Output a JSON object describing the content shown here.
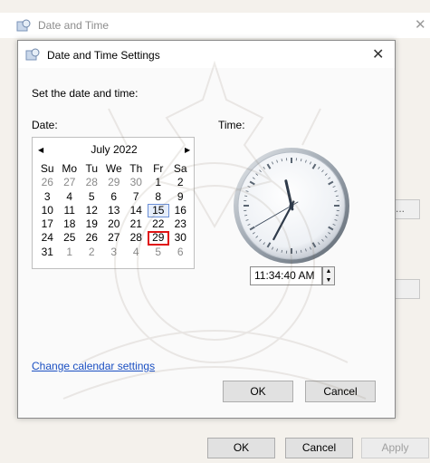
{
  "outer": {
    "title": "Date and Time",
    "close_glyph": "✕",
    "side_button_label": "...",
    "ok_label": "OK",
    "cancel_label": "Cancel",
    "apply_label": "Apply"
  },
  "dialog": {
    "title": "Date and Time Settings",
    "close_glyph": "✕",
    "set_label": "Set the date and time:",
    "date_label": "Date:",
    "time_label": "Time:",
    "link_label": "Change calendar settings",
    "ok_label": "OK",
    "cancel_label": "Cancel"
  },
  "calendar": {
    "month_label": "July 2022",
    "prev_glyph": "◀",
    "next_glyph": "▶",
    "weekdays": [
      "Su",
      "Mo",
      "Tu",
      "We",
      "Th",
      "Fr",
      "Sa"
    ],
    "weeks": [
      [
        {
          "d": "26",
          "o": true
        },
        {
          "d": "27",
          "o": true
        },
        {
          "d": "28",
          "o": true
        },
        {
          "d": "29",
          "o": true
        },
        {
          "d": "30",
          "o": true
        },
        {
          "d": "1"
        },
        {
          "d": "2"
        }
      ],
      [
        {
          "d": "3"
        },
        {
          "d": "4"
        },
        {
          "d": "5"
        },
        {
          "d": "6"
        },
        {
          "d": "7"
        },
        {
          "d": "8"
        },
        {
          "d": "9"
        }
      ],
      [
        {
          "d": "10"
        },
        {
          "d": "11"
        },
        {
          "d": "12"
        },
        {
          "d": "13"
        },
        {
          "d": "14"
        },
        {
          "d": "15",
          "today": true
        },
        {
          "d": "16"
        }
      ],
      [
        {
          "d": "17"
        },
        {
          "d": "18"
        },
        {
          "d": "19"
        },
        {
          "d": "20"
        },
        {
          "d": "21"
        },
        {
          "d": "22"
        },
        {
          "d": "23"
        }
      ],
      [
        {
          "d": "24"
        },
        {
          "d": "25"
        },
        {
          "d": "26"
        },
        {
          "d": "27"
        },
        {
          "d": "28"
        },
        {
          "d": "29",
          "selected": true
        },
        {
          "d": "30"
        }
      ],
      [
        {
          "d": "31"
        },
        {
          "d": "1",
          "o": true
        },
        {
          "d": "2",
          "o": true
        },
        {
          "d": "3",
          "o": true
        },
        {
          "d": "4",
          "o": true
        },
        {
          "d": "5",
          "o": true
        },
        {
          "d": "6",
          "o": true
        }
      ]
    ]
  },
  "clock": {
    "hours": 11,
    "minutes": 34,
    "seconds": 40
  },
  "time_field": {
    "value": "11:34:40 AM",
    "up_glyph": "▲",
    "down_glyph": "▼"
  },
  "colors": {
    "selected_outline": "#e01414",
    "today_outline": "#6b8fd6",
    "link": "#1a4fc2"
  }
}
